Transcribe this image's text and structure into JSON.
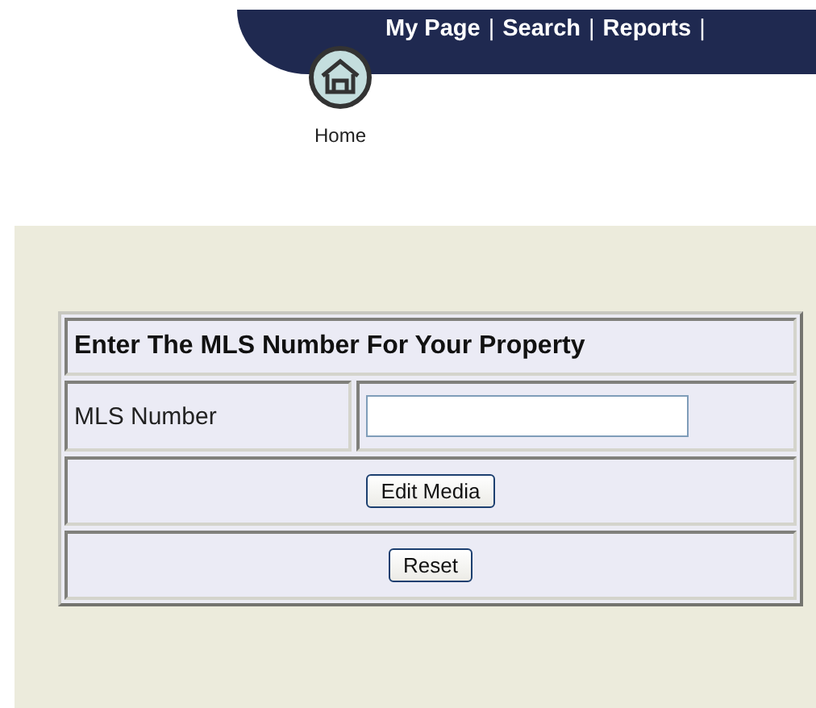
{
  "nav": {
    "links": [
      "My Page",
      "Search",
      "Reports"
    ],
    "separator": "|"
  },
  "home": {
    "label": "Home"
  },
  "form": {
    "title": "Enter The MLS Number For Your Property",
    "field_label": "MLS Number",
    "buttons": [
      "Edit Media",
      "Reset"
    ]
  }
}
